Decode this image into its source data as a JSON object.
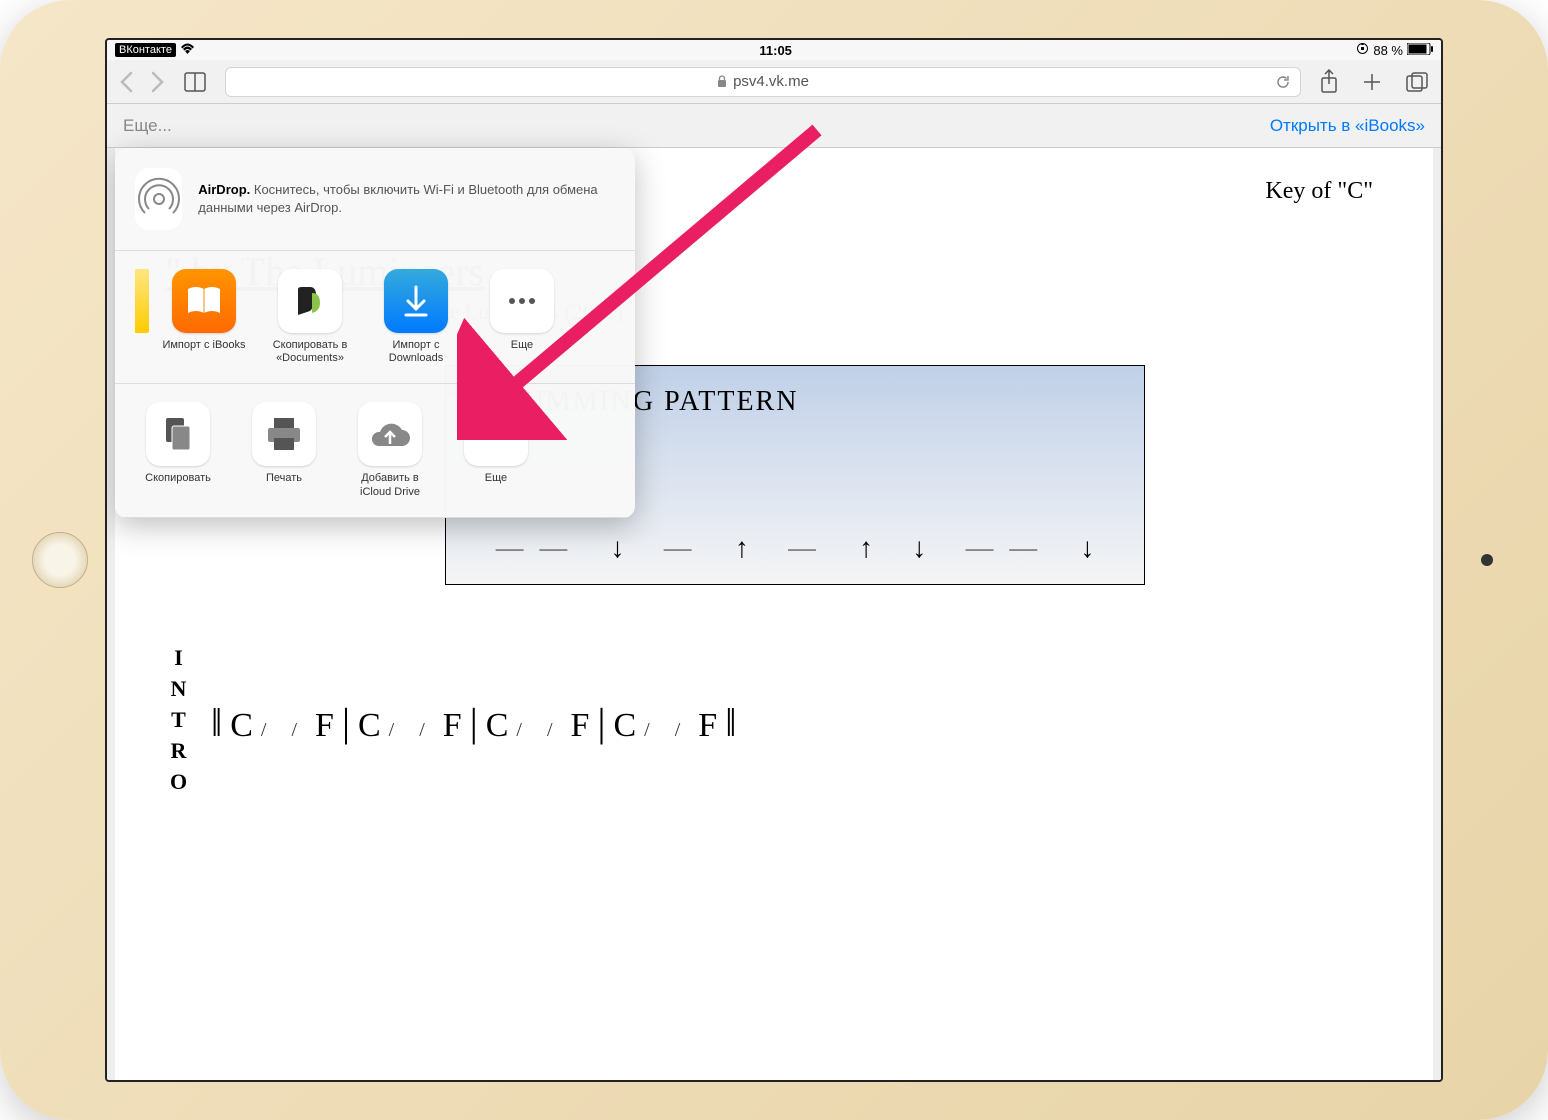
{
  "status": {
    "back_app": "ВКонтакте",
    "time": "11:05",
    "battery": "88 %"
  },
  "toolbar": {
    "url": "psv4.vk.me"
  },
  "action_bar": {
    "more": "Еще...",
    "open": "Открыть в «iBooks»"
  },
  "document": {
    "key": "Key of \"C\"",
    "title_visible": "\" by The Lumineers",
    "subtitle": "The Lumineers (2012)",
    "strum_title": "STRUMMING PATTERN",
    "intro_label": "INTRO",
    "chords": [
      "C",
      "F",
      "C",
      "F",
      "C",
      "F",
      "C",
      "F"
    ]
  },
  "share_sheet": {
    "airdrop_bold": "AirDrop.",
    "airdrop_text": "Коснитесь, чтобы включить Wi-Fi и Bluetooth для обмена данными через AirDrop.",
    "row1": [
      {
        "label": "Импорт с iBooks",
        "icon": "ibooks"
      },
      {
        "label": "Скопировать в «Documents»",
        "icon": "documents"
      },
      {
        "label": "Импорт с Downloads",
        "icon": "downloads"
      },
      {
        "label": "Еще",
        "icon": "more"
      }
    ],
    "row2": [
      {
        "label": "Скопировать",
        "icon": "copy"
      },
      {
        "label": "Печать",
        "icon": "print"
      },
      {
        "label": "Добавить в iCloud Drive",
        "icon": "icloud"
      },
      {
        "label": "Еще",
        "icon": "more"
      }
    ]
  }
}
